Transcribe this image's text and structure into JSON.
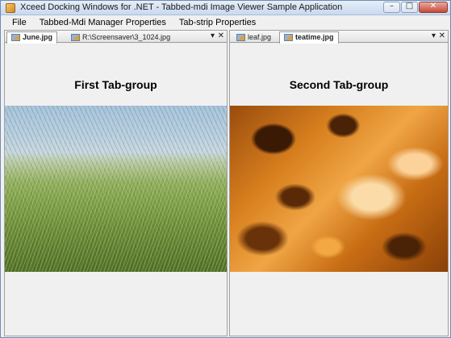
{
  "window": {
    "title": "Xceed Docking Windows for .NET - Tabbed-mdi Image Viewer Sample Application",
    "caption_buttons": [
      {
        "name": "minimize-button",
        "glyph": "–"
      },
      {
        "name": "maximize-button",
        "glyph": "□"
      },
      {
        "name": "close-button",
        "glyph": "✕"
      }
    ]
  },
  "menu": {
    "items": [
      "File",
      "Tabbed-Mdi Manager Properties",
      "Tab-strip Properties"
    ]
  },
  "left_group": {
    "tabs": [
      {
        "label": "June.jpg",
        "active": true
      },
      {
        "label": "R:\\Screensaver\\3_1024.jpg",
        "active": false
      }
    ],
    "dropdown_glyph": "▾",
    "close_glyph": "✕",
    "heading": "First Tab-group",
    "image": "grass-field"
  },
  "right_group": {
    "tabs": [
      {
        "label": "leaf.jpg",
        "active": false
      },
      {
        "label": "teatime.jpg",
        "active": true
      }
    ],
    "dropdown_glyph": "▾",
    "close_glyph": "✕",
    "heading": "Second Tab-group",
    "image": "orange-texture"
  }
}
